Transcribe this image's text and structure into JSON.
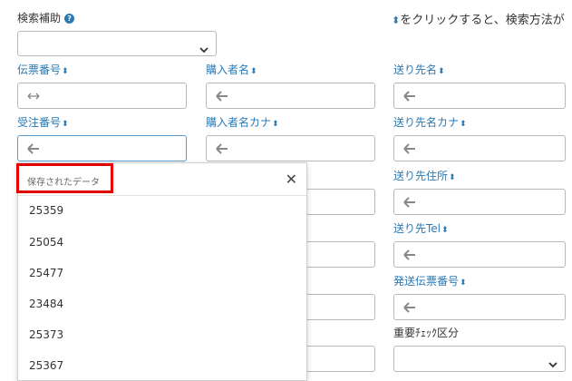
{
  "search_help": {
    "label": "検索補助",
    "help_icon": "question-circle-icon",
    "select_value": ""
  },
  "hint": {
    "sort_icon": "sort-icon",
    "text": "をクリックすると、検索方法が"
  },
  "fields": {
    "voucher_no": {
      "label": "伝票番号"
    },
    "purchaser_name": {
      "label": "購入者名"
    },
    "ship_to_name": {
      "label": "送り先名"
    },
    "order_no": {
      "label": "受注番号"
    },
    "purchaser_kana": {
      "label": "購入者名カナ"
    },
    "ship_to_kana": {
      "label": "送り先名カナ"
    },
    "ship_to_address": {
      "label": "送り先住所"
    },
    "ship_to_tel": {
      "label": "送り先Tel"
    },
    "shipping_voucher_no": {
      "label": "発送伝票番号"
    },
    "important_check": {
      "label": "重要ﾁｪｯｸ区分",
      "value": ""
    },
    "cutoff_label": {
      "label": ""
    }
  },
  "sort_glyph": "⬍",
  "dropdown": {
    "title": "保存されたデータ",
    "close_icon": "close-icon",
    "items": [
      "25359",
      "25054",
      "25477",
      "23484",
      "25373",
      "25367"
    ]
  },
  "colors": {
    "accent": "#2a7ab5",
    "highlight": "#e50000"
  }
}
